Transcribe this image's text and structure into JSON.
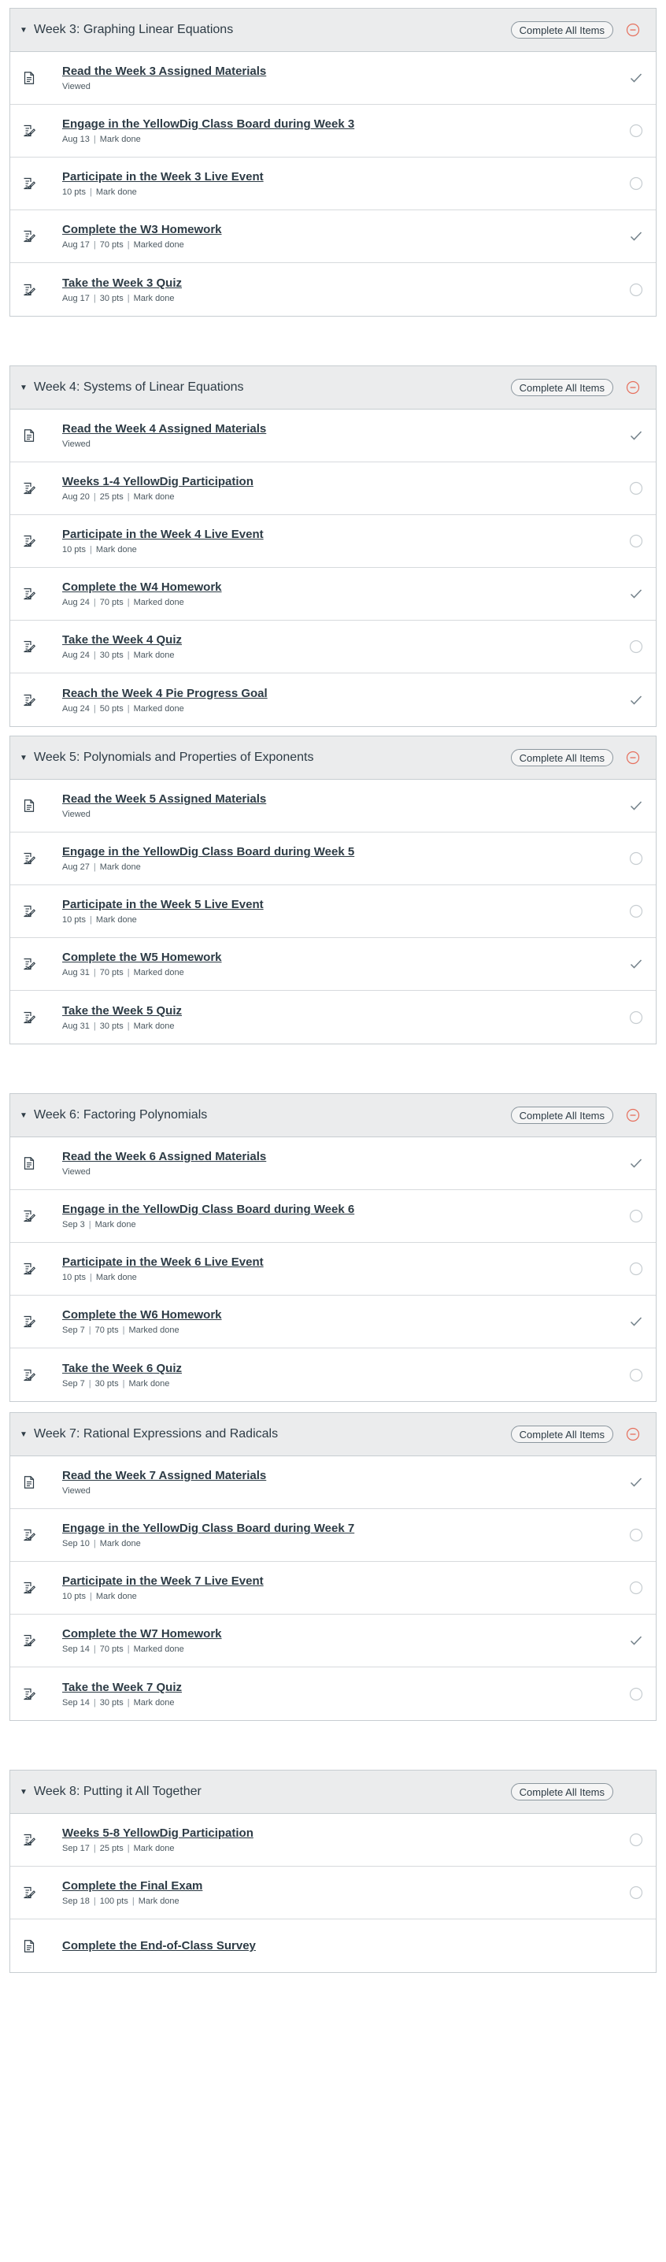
{
  "labels": {
    "complete_all": "Complete All Items"
  },
  "colors": {
    "text": "#2d3b45",
    "header_bg": "#ebeced",
    "border": "#c7cdd1",
    "complete_check": "#73818a",
    "incomplete_circle": "#c7cdd1",
    "header_status_accent": "#e66f5c"
  },
  "modules": [
    {
      "title": "Week 3: Graphing Linear Equations",
      "header_status_icon": "minus-circle-icon",
      "items": [
        {
          "title": "Read the Week 3 Assigned Materials",
          "meta": [
            "Viewed"
          ],
          "icon": "page-icon",
          "status": "complete"
        },
        {
          "title": "Engage in the YellowDig Class Board during Week 3",
          "meta": [
            "Aug 13",
            "Mark done"
          ],
          "icon": "assignment-icon",
          "status": "incomplete"
        },
        {
          "title": "Participate in the Week 3 Live Event",
          "meta": [
            "10 pts",
            "Mark done"
          ],
          "icon": "assignment-icon",
          "status": "incomplete"
        },
        {
          "title": "Complete the W3 Homework",
          "meta": [
            "Aug 17",
            "70 pts",
            "Marked done"
          ],
          "icon": "assignment-icon",
          "status": "complete"
        },
        {
          "title": "Take the Week 3 Quiz",
          "meta": [
            "Aug 17",
            "30 pts",
            "Mark done"
          ],
          "icon": "assignment-icon",
          "status": "incomplete"
        }
      ]
    },
    {
      "title": "Week 4: Systems of Linear Equations",
      "header_status_icon": "minus-circle-icon",
      "items": [
        {
          "title": "Read the Week 4 Assigned Materials",
          "meta": [
            "Viewed"
          ],
          "icon": "page-icon",
          "status": "complete"
        },
        {
          "title": "Weeks 1-4 YellowDig Participation",
          "meta": [
            "Aug 20",
            "25 pts",
            "Mark done"
          ],
          "icon": "assignment-icon",
          "status": "incomplete"
        },
        {
          "title": "Participate in the Week 4 Live Event",
          "meta": [
            "10 pts",
            "Mark done"
          ],
          "icon": "assignment-icon",
          "status": "incomplete"
        },
        {
          "title": "Complete the W4 Homework",
          "meta": [
            "Aug 24",
            "70 pts",
            "Marked done"
          ],
          "icon": "assignment-icon",
          "status": "complete"
        },
        {
          "title": "Take the Week 4 Quiz",
          "meta": [
            "Aug 24",
            "30 pts",
            "Mark done"
          ],
          "icon": "assignment-icon",
          "status": "incomplete"
        },
        {
          "title": "Reach the Week 4 Pie Progress Goal",
          "meta": [
            "Aug 24",
            "50 pts",
            "Marked done"
          ],
          "icon": "assignment-icon",
          "status": "complete"
        }
      ]
    },
    {
      "title": "Week 5: Polynomials and Properties of Exponents",
      "header_status_icon": "minus-circle-icon",
      "items": [
        {
          "title": "Read the Week 5 Assigned Materials",
          "meta": [
            "Viewed"
          ],
          "icon": "page-icon",
          "status": "complete"
        },
        {
          "title": "Engage in the YellowDig Class Board during Week 5",
          "meta": [
            "Aug 27",
            "Mark done"
          ],
          "icon": "assignment-icon",
          "status": "incomplete"
        },
        {
          "title": "Participate in the Week 5 Live Event",
          "meta": [
            "10 pts",
            "Mark done"
          ],
          "icon": "assignment-icon",
          "status": "incomplete"
        },
        {
          "title": "Complete the W5 Homework",
          "meta": [
            "Aug 31",
            "70 pts",
            "Marked done"
          ],
          "icon": "assignment-icon",
          "status": "complete"
        },
        {
          "title": "Take the Week 5 Quiz",
          "meta": [
            "Aug 31",
            "30 pts",
            "Mark done"
          ],
          "icon": "assignment-icon",
          "status": "incomplete"
        }
      ]
    },
    {
      "title": "Week 6: Factoring Polynomials",
      "header_status_icon": "minus-circle-icon",
      "items": [
        {
          "title": "Read the Week 6 Assigned Materials",
          "meta": [
            "Viewed"
          ],
          "icon": "page-icon",
          "status": "complete"
        },
        {
          "title": "Engage in the YellowDig Class Board during Week 6",
          "meta": [
            "Sep 3",
            "Mark done"
          ],
          "icon": "assignment-icon",
          "status": "incomplete"
        },
        {
          "title": "Participate in the Week 6 Live Event",
          "meta": [
            "10 pts",
            "Mark done"
          ],
          "icon": "assignment-icon",
          "status": "incomplete"
        },
        {
          "title": "Complete the W6 Homework",
          "meta": [
            "Sep 7",
            "70 pts",
            "Marked done"
          ],
          "icon": "assignment-icon",
          "status": "complete"
        },
        {
          "title": "Take the Week 6 Quiz",
          "meta": [
            "Sep 7",
            "30 pts",
            "Mark done"
          ],
          "icon": "assignment-icon",
          "status": "incomplete"
        }
      ]
    },
    {
      "title": "Week 7: Rational Expressions and Radicals",
      "header_status_icon": "minus-circle-icon",
      "items": [
        {
          "title": "Read the Week 7 Assigned Materials",
          "meta": [
            "Viewed"
          ],
          "icon": "page-icon",
          "status": "complete"
        },
        {
          "title": "Engage in the YellowDig Class Board during Week 7",
          "meta": [
            "Sep 10",
            "Mark done"
          ],
          "icon": "assignment-icon",
          "status": "incomplete"
        },
        {
          "title": "Participate in the Week 7 Live Event",
          "meta": [
            "10 pts",
            "Mark done"
          ],
          "icon": "assignment-icon",
          "status": "incomplete"
        },
        {
          "title": "Complete the W7 Homework",
          "meta": [
            "Sep 14",
            "70 pts",
            "Marked done"
          ],
          "icon": "assignment-icon",
          "status": "complete"
        },
        {
          "title": "Take the Week 7 Quiz",
          "meta": [
            "Sep 14",
            "30 pts",
            "Mark done"
          ],
          "icon": "assignment-icon",
          "status": "incomplete"
        }
      ]
    },
    {
      "title": "Week 8: Putting it All Together",
      "header_status_icon": "",
      "items": [
        {
          "title": "Weeks 5-8 YellowDig Participation",
          "meta": [
            "Sep 17",
            "25 pts",
            "Mark done"
          ],
          "icon": "assignment-icon",
          "status": "incomplete"
        },
        {
          "title": "Complete the Final Exam",
          "meta": [
            "Sep 18",
            "100 pts",
            "Mark done"
          ],
          "icon": "assignment-icon",
          "status": "incomplete"
        },
        {
          "title": "Complete the End-of-Class Survey",
          "meta": [],
          "icon": "page-icon",
          "status": "none"
        }
      ]
    }
  ]
}
